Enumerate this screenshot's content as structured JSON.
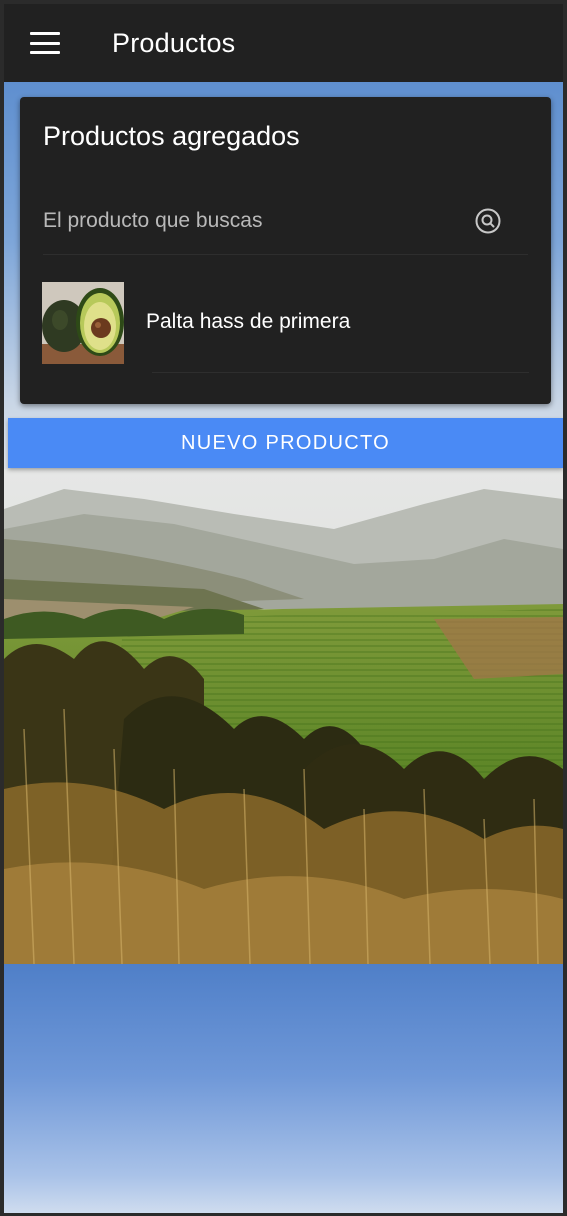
{
  "appbar": {
    "title": "Productos",
    "menu_icon": "hamburger-menu-icon"
  },
  "card": {
    "title": "Productos agregados",
    "search": {
      "placeholder": "El producto que buscas",
      "value": "",
      "icon": "search-icon"
    },
    "products": [
      {
        "name": "Palta hass de primera",
        "image": "avocado-thumbnail"
      }
    ]
  },
  "actions": {
    "new_product_label": "NUEVO PRODUCTO"
  },
  "colors": {
    "appbar_bg": "#212121",
    "card_bg": "#212121",
    "primary_button": "#4a8af5",
    "text_primary": "#ffffff",
    "text_placeholder": "#b9b9b9"
  }
}
